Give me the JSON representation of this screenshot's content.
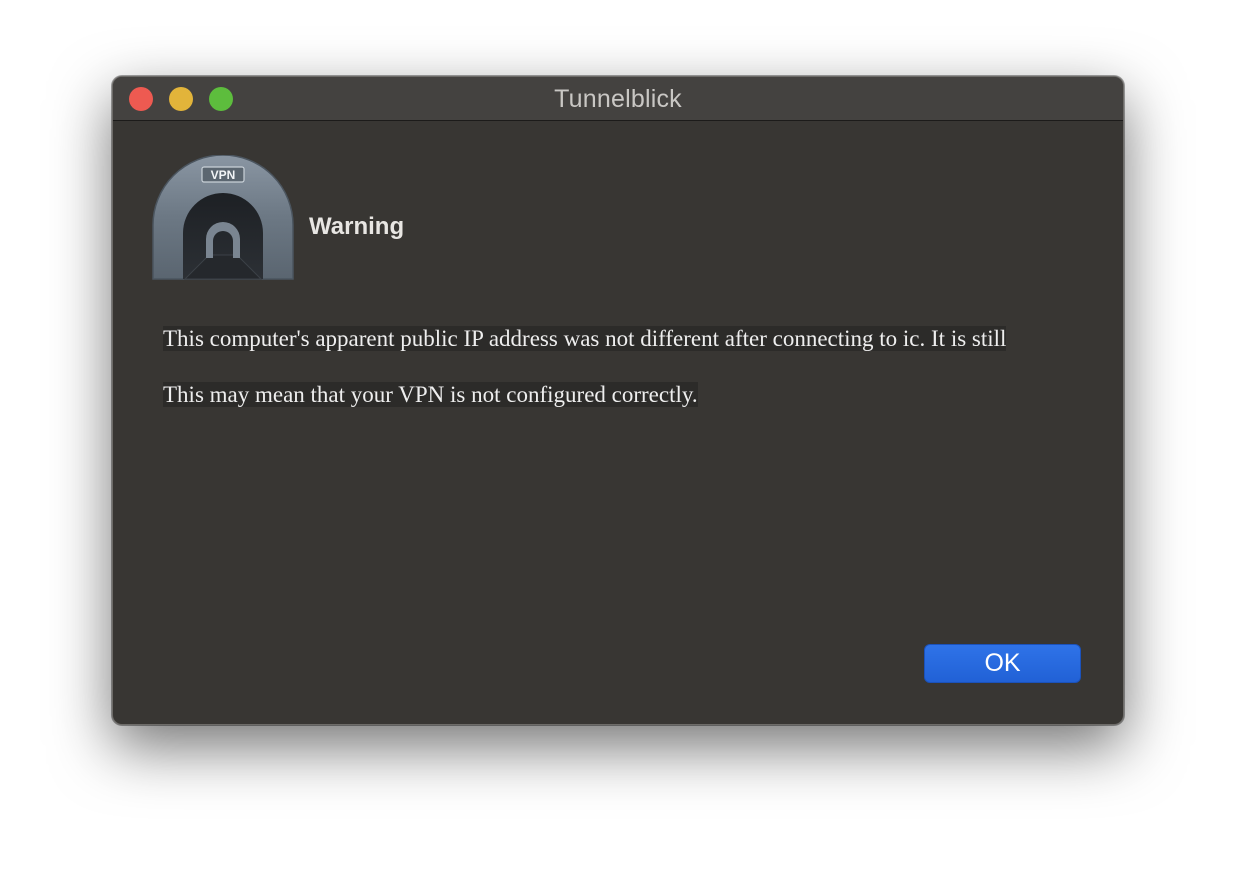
{
  "window": {
    "title": "Tunnelblick"
  },
  "icon": {
    "name": "tunnelblick-vpn-icon",
    "label": "VPN"
  },
  "dialog": {
    "heading": "Warning",
    "message_line1": "This computer's apparent public IP address was not different after connecting to ic. It is still",
    "message_line2": "This may mean that your VPN is not configured correctly.",
    "ok_label": "OK"
  },
  "colors": {
    "close": "#ee5a51",
    "minimize": "#e2b43a",
    "zoom": "#5dbd3d",
    "accent": "#2a6ae0"
  }
}
